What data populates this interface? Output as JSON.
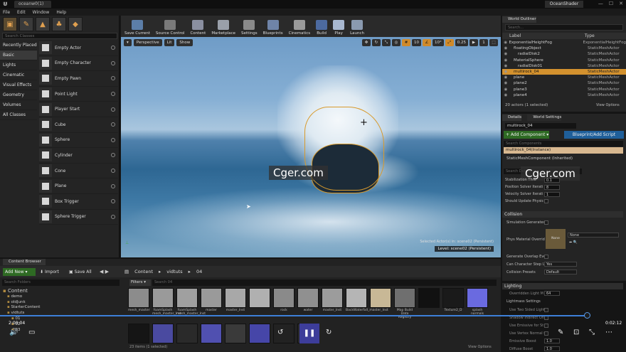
{
  "window": {
    "tab_title": "oceanw0(1)",
    "app_title": "OceanShader",
    "controls": [
      "—",
      "☐",
      "✕"
    ]
  },
  "menu": [
    "File",
    "Edit",
    "Window",
    "Help"
  ],
  "modes": {
    "search_placeholder": "Search Classes",
    "categories": [
      "Recently Placed",
      "Basic",
      "Lights",
      "Cinematic",
      "Visual Effects",
      "Geometry",
      "Volumes",
      "All Classes"
    ],
    "selected_category": "Basic",
    "items": [
      "Empty Actor",
      "Empty Character",
      "Empty Pawn",
      "Point Light",
      "Player Start",
      "Cube",
      "Sphere",
      "Cylinder",
      "Cone",
      "Plane",
      "Box Trigger",
      "Sphere Trigger"
    ]
  },
  "toolbar": {
    "buttons": [
      {
        "label": "Save Current",
        "color": "#5c7ea8"
      },
      {
        "label": "Source Control",
        "color": "#7a7a7a"
      },
      {
        "label": "Content",
        "color": "#8a8fa0"
      },
      {
        "label": "Marketplace",
        "color": "#9aa0aa"
      },
      {
        "label": "Settings",
        "color": "#8a8a8a"
      },
      {
        "label": "Blueprints",
        "color": "#6f84a8"
      },
      {
        "label": "Cinematics",
        "color": "#9a9a9a"
      },
      {
        "label": "Build",
        "color": "#4c6aa0"
      },
      {
        "label": "Play",
        "color": "#a8b8d0"
      },
      {
        "label": "Launch",
        "color": "#8a9ab0"
      }
    ]
  },
  "viewport": {
    "view_mode": "Perspective",
    "lighting": "Lit",
    "show": "Show",
    "snap_values": [
      "10",
      "10°",
      "0.25",
      "1"
    ],
    "selected_actor_label": "Selected Actor(s) in: scene02 (Persistent)",
    "level_label": "Level: scene02 (Persistent)",
    "watermark": "Cger.com"
  },
  "outliner": {
    "tab": "World Outliner",
    "search_placeholder": "Search...",
    "col_label": "Label",
    "col_type": "Type",
    "rows": [
      {
        "label": "ExponentialHeightFog",
        "type": "ExponentialHeightFog",
        "indent": 0,
        "selected": false
      },
      {
        "label": "floatingObject",
        "type": "StaticMeshActor",
        "indent": 1,
        "selected": false
      },
      {
        "label": "radialDisk2",
        "type": "StaticMeshActor",
        "indent": 2,
        "selected": false
      },
      {
        "label": "MaterialSphere",
        "type": "StaticMeshActor",
        "indent": 1,
        "selected": false
      },
      {
        "label": "radialDisk01",
        "type": "StaticMeshActor",
        "indent": 2,
        "selected": false
      },
      {
        "label": "multirock_04",
        "type": "StaticMeshActor",
        "indent": 1,
        "selected": true
      },
      {
        "label": "plane",
        "type": "StaticMeshActor",
        "indent": 1,
        "selected": false
      },
      {
        "label": "plane2",
        "type": "StaticMeshActor",
        "indent": 1,
        "selected": false
      },
      {
        "label": "plane3",
        "type": "StaticMeshActor",
        "indent": 1,
        "selected": false
      },
      {
        "label": "plane4",
        "type": "StaticMeshActor",
        "indent": 1,
        "selected": false
      }
    ],
    "footer": "20 actors (1 selected)",
    "view_options": "View Options"
  },
  "details": {
    "tab_details": "Details",
    "tab_world": "World Settings",
    "actor_name": "multirock_04",
    "add_component": "+ Add Component ▾",
    "blueprint_script": "Blueprint/Add Script",
    "search_components": "Search Components",
    "component_instance": "multirock_04(Instance)",
    "component_mesh": "StaticMeshComponent (Inherited)",
    "search_details": "Search Details",
    "props_top": [
      {
        "label": "Stabilization Thre",
        "value": "0.1"
      },
      {
        "label": "Position Solver Iterati",
        "value": "8"
      },
      {
        "label": "Velocity Solver Iterati",
        "value": "1"
      },
      {
        "label": "Should Update Physic",
        "value": ""
      }
    ],
    "collision": {
      "title": "Collision",
      "sim_generates": "Simulation Generates",
      "phys_material": "Phys Material Overrid",
      "material_value": "None",
      "material_thumb": "None",
      "overlap": "Generate Overlap Eve",
      "can_step": "Can Character Step Up",
      "can_step_value": "Yes",
      "presets": "Collision Presets",
      "presets_value": "Default"
    },
    "lighting": {
      "title": "Lighting",
      "overridden": "Overridden Light M",
      "overridden_value": "64",
      "lightmass": "Lightmass Settings",
      "two_sided": "Use Two Sided Light",
      "shadow_indirect": "Shadow Indirect Only",
      "emissive": "Use Emissive for St",
      "vertex_normal": "Use Vertex Normal f",
      "emissive_boost": "Emissive Boost",
      "emissive_boost_value": "1.0",
      "diffuse_boost": "Diffuse Boost",
      "diffuse_boost_value": "1.0"
    }
  },
  "content_browser": {
    "tab": "Content Browser",
    "add_new": "Add New ▾",
    "import": "Import",
    "save_all": "Save All",
    "path": [
      "Content",
      "vidtuts",
      "04"
    ],
    "search_folders": "Search Folders",
    "tree": [
      "Content",
      "demo",
      "oldJunk",
      "StarterContent",
      "vidtuts",
      "01",
      "02",
      "03"
    ],
    "filters": "Filters ▾",
    "search_placeholder": "Search 04",
    "assets_row1": [
      {
        "caption": "mesh_master",
        "color": "#8c8c8c"
      },
      {
        "caption": "foamSplash mesh_master_Inst",
        "color": "#9a9a9a"
      },
      {
        "caption": "foamSplash mesh_master_Inst",
        "color": "#a0a0a0"
      },
      {
        "caption": "master",
        "color": "#9a9a9a"
      },
      {
        "caption": "master_Inst",
        "color": "#a8a8a8"
      },
      {
        "caption": "",
        "color": "#b0b0b0"
      },
      {
        "caption": "rock",
        "color": "#8a8a8a"
      },
      {
        "caption": "water",
        "color": "#909090"
      },
      {
        "caption": "master_Inst",
        "color": "#9c9c9c"
      },
      {
        "caption": "BackWaterfall_master_Inst",
        "color": "#b5b5b5"
      },
      {
        "caption": "",
        "color": "#c8b896"
      },
      {
        "caption": "Map Build Data Registry",
        "color": "#6f6f6f"
      },
      {
        "caption": "",
        "color": "#111111"
      },
      {
        "caption": "Texture2_D",
        "color": "#1a1a1a"
      },
      {
        "caption": "splash normals",
        "color": "#6a6ae0"
      }
    ],
    "assets_row2": [
      {
        "caption": "",
        "color": "#151515"
      },
      {
        "caption": "",
        "color": "#4a4aa0"
      },
      {
        "caption": "",
        "color": "#2a2a2a"
      },
      {
        "caption": "",
        "color": "#5050b0"
      },
      {
        "caption": "",
        "color": "#3a3a3a"
      },
      {
        "caption": "",
        "color": "#4646a8"
      },
      {
        "caption": "",
        "color": "#222222"
      },
      {
        "caption": "",
        "color": "#2a2a2a"
      }
    ],
    "footer": "23 items (1 selected)",
    "view_options": "View Options"
  },
  "video": {
    "time_elapsed": "2:00:04",
    "time_total": "0:02:12",
    "progress": 0.97
  }
}
